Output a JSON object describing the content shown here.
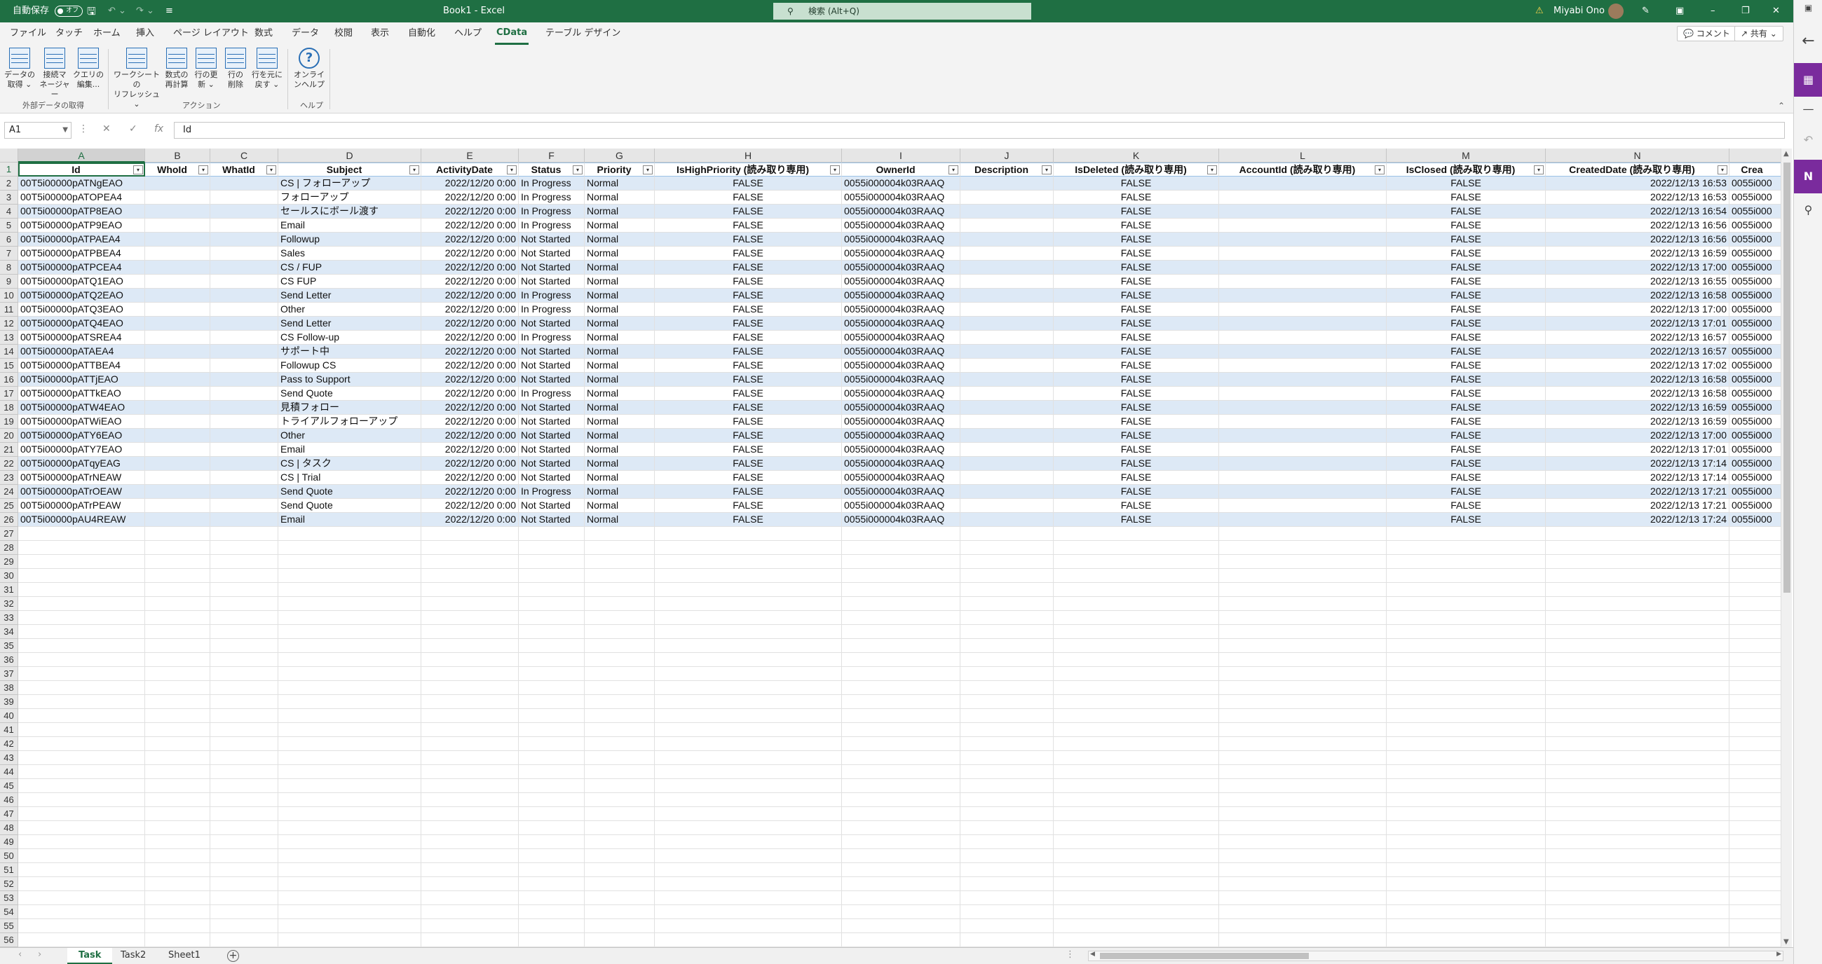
{
  "titlebar": {
    "autosave_label": "自動保存",
    "autosave_state": "オフ",
    "doc_title": "Book1  -  Excel",
    "search_placeholder": "検索 (Alt+Q)",
    "user_name": "Miyabi Ono"
  },
  "ribbon_tabs": [
    "ファイル",
    "タッチ",
    "ホーム",
    "挿入",
    "ページ レイアウト",
    "数式",
    "データ",
    "校閲",
    "表示",
    "自動化",
    "ヘルプ",
    "CData",
    "テーブル デザイン"
  ],
  "ribbon_right": {
    "comment": "コメント",
    "share": "共有"
  },
  "ribbon": {
    "buttons": [
      {
        "l1": "データの",
        "l2": "取得 ⌄"
      },
      {
        "l1": "接続マ",
        "l2": "ネージャー"
      },
      {
        "l1": "クエリの",
        "l2": "編集..."
      },
      {
        "l1": "ワークシートの",
        "l2": "リフレッシュ ⌄"
      },
      {
        "l1": "数式の",
        "l2": "再計算"
      },
      {
        "l1": "行の更",
        "l2": "新 ⌄"
      },
      {
        "l1": "行の",
        "l2": "削除"
      },
      {
        "l1": "行を元に",
        "l2": "戻す ⌄"
      },
      {
        "l1": "オンライ",
        "l2": "ンヘルプ"
      }
    ],
    "groups": [
      "外部データの取得",
      "アクション",
      "ヘルプ"
    ]
  },
  "formulabar": {
    "namebox": "A1",
    "fx": "fx",
    "value": "Id"
  },
  "columns": [
    "A",
    "B",
    "C",
    "D",
    "E",
    "F",
    "G",
    "H",
    "I",
    "J",
    "K",
    "L",
    "M",
    "N",
    ""
  ],
  "headers": [
    "Id",
    "WhoId",
    "WhatId",
    "Subject",
    "ActivityDate",
    "Status",
    "Priority",
    "IsHighPriority (読み取り専用)",
    "OwnerId",
    "Description",
    "IsDeleted (読み取り専用)",
    "AccountId (読み取り専用)",
    "IsClosed (読み取り専用)",
    "CreatedDate (読み取り専用)",
    "Crea"
  ],
  "rows": [
    [
      "00T5i00000pATNgEAO",
      "",
      "",
      "CS | フォローアップ",
      "2022/12/20 0:00",
      "In Progress",
      "Normal",
      "FALSE",
      "0055i000004k03RAAQ",
      "",
      "FALSE",
      "",
      "FALSE",
      "2022/12/13 16:53",
      "0055i000"
    ],
    [
      "00T5i00000pATOPEA4",
      "",
      "",
      "フォローアップ",
      "2022/12/20 0:00",
      "In Progress",
      "Normal",
      "FALSE",
      "0055i000004k03RAAQ",
      "",
      "FALSE",
      "",
      "FALSE",
      "2022/12/13 16:53",
      "0055i000"
    ],
    [
      "00T5i00000pATP8EAO",
      "",
      "",
      "セールスにボール渡す",
      "2022/12/20 0:00",
      "In Progress",
      "Normal",
      "FALSE",
      "0055i000004k03RAAQ",
      "",
      "FALSE",
      "",
      "FALSE",
      "2022/12/13 16:54",
      "0055i000"
    ],
    [
      "00T5i00000pATP9EAO",
      "",
      "",
      "Email",
      "2022/12/20 0:00",
      "In Progress",
      "Normal",
      "FALSE",
      "0055i000004k03RAAQ",
      "",
      "FALSE",
      "",
      "FALSE",
      "2022/12/13 16:56",
      "0055i000"
    ],
    [
      "00T5i00000pATPAEA4",
      "",
      "",
      "Followup",
      "2022/12/20 0:00",
      "Not Started",
      "Normal",
      "FALSE",
      "0055i000004k03RAAQ",
      "",
      "FALSE",
      "",
      "FALSE",
      "2022/12/13 16:56",
      "0055i000"
    ],
    [
      "00T5i00000pATPBEA4",
      "",
      "",
      "Sales",
      "2022/12/20 0:00",
      "Not Started",
      "Normal",
      "FALSE",
      "0055i000004k03RAAQ",
      "",
      "FALSE",
      "",
      "FALSE",
      "2022/12/13 16:59",
      "0055i000"
    ],
    [
      "00T5i00000pATPCEA4",
      "",
      "",
      "CS / FUP",
      "2022/12/20 0:00",
      "Not Started",
      "Normal",
      "FALSE",
      "0055i000004k03RAAQ",
      "",
      "FALSE",
      "",
      "FALSE",
      "2022/12/13 17:00",
      "0055i000"
    ],
    [
      "00T5i00000pATQ1EAO",
      "",
      "",
      "CS FUP",
      "2022/12/20 0:00",
      "Not Started",
      "Normal",
      "FALSE",
      "0055i000004k03RAAQ",
      "",
      "FALSE",
      "",
      "FALSE",
      "2022/12/13 16:55",
      "0055i000"
    ],
    [
      "00T5i00000pATQ2EAO",
      "",
      "",
      "Send Letter",
      "2022/12/20 0:00",
      "In Progress",
      "Normal",
      "FALSE",
      "0055i000004k03RAAQ",
      "",
      "FALSE",
      "",
      "FALSE",
      "2022/12/13 16:58",
      "0055i000"
    ],
    [
      "00T5i00000pATQ3EAO",
      "",
      "",
      "Other",
      "2022/12/20 0:00",
      "In Progress",
      "Normal",
      "FALSE",
      "0055i000004k03RAAQ",
      "",
      "FALSE",
      "",
      "FALSE",
      "2022/12/13 17:00",
      "0055i000"
    ],
    [
      "00T5i00000pATQ4EAO",
      "",
      "",
      "Send Letter",
      "2022/12/20 0:00",
      "Not Started",
      "Normal",
      "FALSE",
      "0055i000004k03RAAQ",
      "",
      "FALSE",
      "",
      "FALSE",
      "2022/12/13 17:01",
      "0055i000"
    ],
    [
      "00T5i00000pATSREA4",
      "",
      "",
      "CS Follow-up",
      "2022/12/20 0:00",
      "In Progress",
      "Normal",
      "FALSE",
      "0055i000004k03RAAQ",
      "",
      "FALSE",
      "",
      "FALSE",
      "2022/12/13 16:57",
      "0055i000"
    ],
    [
      "00T5i00000pATAEA4",
      "",
      "",
      "サポート中",
      "2022/12/20 0:00",
      "Not Started",
      "Normal",
      "FALSE",
      "0055i000004k03RAAQ",
      "",
      "FALSE",
      "",
      "FALSE",
      "2022/12/13 16:57",
      "0055i000"
    ],
    [
      "00T5i00000pATTBEA4",
      "",
      "",
      "Followup  CS",
      "2022/12/20 0:00",
      "Not Started",
      "Normal",
      "FALSE",
      "0055i000004k03RAAQ",
      "",
      "FALSE",
      "",
      "FALSE",
      "2022/12/13 17:02",
      "0055i000"
    ],
    [
      "00T5i00000pATTjEAO",
      "",
      "",
      "Pass to Support",
      "2022/12/20 0:00",
      "Not Started",
      "Normal",
      "FALSE",
      "0055i000004k03RAAQ",
      "",
      "FALSE",
      "",
      "FALSE",
      "2022/12/13 16:58",
      "0055i000"
    ],
    [
      "00T5i00000pATTkEAO",
      "",
      "",
      "Send Quote",
      "2022/12/20 0:00",
      "In Progress",
      "Normal",
      "FALSE",
      "0055i000004k03RAAQ",
      "",
      "FALSE",
      "",
      "FALSE",
      "2022/12/13 16:58",
      "0055i000"
    ],
    [
      "00T5i00000pATW4EAO",
      "",
      "",
      "見積フォロー",
      "2022/12/20 0:00",
      "Not Started",
      "Normal",
      "FALSE",
      "0055i000004k03RAAQ",
      "",
      "FALSE",
      "",
      "FALSE",
      "2022/12/13 16:59",
      "0055i000"
    ],
    [
      "00T5i00000pATWiEAO",
      "",
      "",
      "トライアルフォローアップ",
      "2022/12/20 0:00",
      "Not Started",
      "Normal",
      "FALSE",
      "0055i000004k03RAAQ",
      "",
      "FALSE",
      "",
      "FALSE",
      "2022/12/13 16:59",
      "0055i000"
    ],
    [
      "00T5i00000pATY6EAO",
      "",
      "",
      "Other",
      "2022/12/20 0:00",
      "Not Started",
      "Normal",
      "FALSE",
      "0055i000004k03RAAQ",
      "",
      "FALSE",
      "",
      "FALSE",
      "2022/12/13 17:00",
      "0055i000"
    ],
    [
      "00T5i00000pATY7EAO",
      "",
      "",
      "Email",
      "2022/12/20 0:00",
      "Not Started",
      "Normal",
      "FALSE",
      "0055i000004k03RAAQ",
      "",
      "FALSE",
      "",
      "FALSE",
      "2022/12/13 17:01",
      "0055i000"
    ],
    [
      "00T5i00000pATqyEAG",
      "",
      "",
      "CS | タスク",
      "2022/12/20 0:00",
      "Not Started",
      "Normal",
      "FALSE",
      "0055i000004k03RAAQ",
      "",
      "FALSE",
      "",
      "FALSE",
      "2022/12/13 17:14",
      "0055i000"
    ],
    [
      "00T5i00000pATrNEAW",
      "",
      "",
      "CS | Trial",
      "2022/12/20 0:00",
      "Not Started",
      "Normal",
      "FALSE",
      "0055i000004k03RAAQ",
      "",
      "FALSE",
      "",
      "FALSE",
      "2022/12/13 17:14",
      "0055i000"
    ],
    [
      "00T5i00000pATrOEAW",
      "",
      "",
      "Send Quote",
      "2022/12/20 0:00",
      "In Progress",
      "Normal",
      "FALSE",
      "0055i000004k03RAAQ",
      "",
      "FALSE",
      "",
      "FALSE",
      "2022/12/13 17:21",
      "0055i000"
    ],
    [
      "00T5i00000pATrPEAW",
      "",
      "",
      "Send Quote",
      "2022/12/20 0:00",
      "Not Started",
      "Normal",
      "FALSE",
      "0055i000004k03RAAQ",
      "",
      "FALSE",
      "",
      "FALSE",
      "2022/12/13 17:21",
      "0055i000"
    ],
    [
      "00T5i00000pAU4REAW",
      "",
      "",
      "Email",
      "2022/12/20 0:00",
      "Not Started",
      "Normal",
      "FALSE",
      "0055i000004k03RAAQ",
      "",
      "FALSE",
      "",
      "FALSE",
      "2022/12/13 17:24",
      "0055i000"
    ]
  ],
  "row_count": 56,
  "sheets": [
    "Task",
    "Task2",
    "Sheet1"
  ],
  "active_sheet": "Task",
  "colors": {
    "excel_green": "#1f6f43",
    "band_blue": "#dde9f6",
    "header_rule": "#9bc2e6"
  }
}
